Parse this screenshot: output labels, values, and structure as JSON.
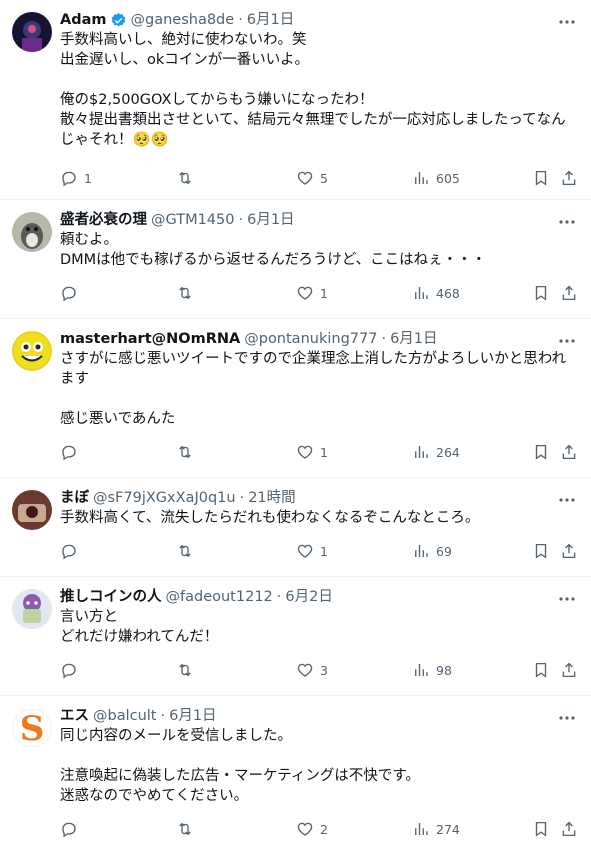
{
  "tweets": [
    {
      "name": "Adam",
      "handle": "@ganesha8de",
      "time": "6月1日",
      "verified": true,
      "body": "手数料高いし、絶対に使わないわ。笑\n出金遅いし、okコインが一番いいよ。\n\n俺の$2,500GOXしてからもう嫌いになったわ！\n散々提出書類出させといて、結局元々無理でしたが一応対応しましたってなんじゃそれ！🥺🥺",
      "replies": "1",
      "retweets": "",
      "likes": "5",
      "views": "605",
      "avatar_color": "#1a1a3a"
    },
    {
      "name": "盛者必衰の理",
      "handle": "@GTM1450",
      "time": "6月1日",
      "verified": false,
      "body": "頼むよ。\nDMMは他でも稼げるから返せるんだろうけど、ここはねぇ・・・",
      "replies": "",
      "retweets": "",
      "likes": "1",
      "views": "468",
      "avatar_color": "#8a8f7a"
    },
    {
      "name": "masterhart@NOmRNA",
      "handle": "@pontanuking777",
      "time": "6月1日",
      "verified": false,
      "body": "さすがに感じ悪いツイートですので企業理念上消した方がよろしいかと思われます\n\n感じ悪いであんた",
      "replies": "",
      "retweets": "",
      "likes": "1",
      "views": "264",
      "avatar_color": "#e0d020"
    },
    {
      "name": "まぼ",
      "handle": "@sF79jXGxXaJ0q1u",
      "time": "21時間",
      "verified": false,
      "body": "手数料高くて、流失したらだれも使わなくなるぞこんなところ。",
      "replies": "",
      "retweets": "",
      "likes": "1",
      "views": "69",
      "avatar_color": "#7a3a2a"
    },
    {
      "name": "推しコインの人",
      "handle": "@fadeout1212",
      "time": "6月2日",
      "verified": false,
      "body": "言い方と\nどれだけ嫌われてんだ！",
      "replies": "",
      "retweets": "",
      "likes": "3",
      "views": "98",
      "avatar_color": "#c8d8e8"
    },
    {
      "name": "エス",
      "handle": "@balcult",
      "time": "6月1日",
      "verified": false,
      "body": "同じ内容のメールを受信しました。\n\n注意喚起に偽装した広告・マーケティングは不快です。\n迷惑なのでやめてください。",
      "replies": "",
      "retweets": "",
      "likes": "2",
      "views": "274",
      "avatar_color": "#ffffff"
    }
  ],
  "icons": {
    "reply": "reply-icon",
    "retweet": "retweet-icon",
    "like": "heart-icon",
    "views": "views-icon",
    "bookmark": "bookmark-icon",
    "share": "share-icon",
    "more": "more-icon",
    "verified": "verified-badge-icon"
  },
  "colors": {
    "verified": "#1d9bf0",
    "muted": "#536471",
    "text": "#0f1419"
  }
}
